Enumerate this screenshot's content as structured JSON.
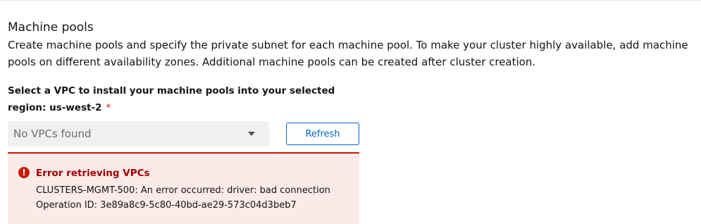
{
  "section": {
    "title": "Machine pools",
    "description": "Create machine pools and specify the private subnet for each machine pool. To make your cluster highly available, add machine pools on different availability zones. Additional machine pools can be created after cluster creation."
  },
  "vpc_field": {
    "label": "Select a VPC to install your machine pools into your selected region: us-west-2",
    "required_marker": "*",
    "select_value": "No VPCs found",
    "select_icon": "caret-down-icon",
    "refresh_label": "Refresh"
  },
  "error_alert": {
    "icon": "exclamation-circle-icon",
    "icon_glyph": "!",
    "title": "Error retrieving VPCs",
    "message": "CLUSTERS-MGMT-500: An error occurred: driver: bad connection",
    "operation": "Operation ID: 3e89a8c9-5c80-40bd-ae29-573c04d3beb7"
  },
  "colors": {
    "link": "#0066cc",
    "danger": "#c9190b",
    "danger_text": "#a30000",
    "danger_bg": "#faeae8",
    "disabled_bg": "#f0f0f0"
  }
}
